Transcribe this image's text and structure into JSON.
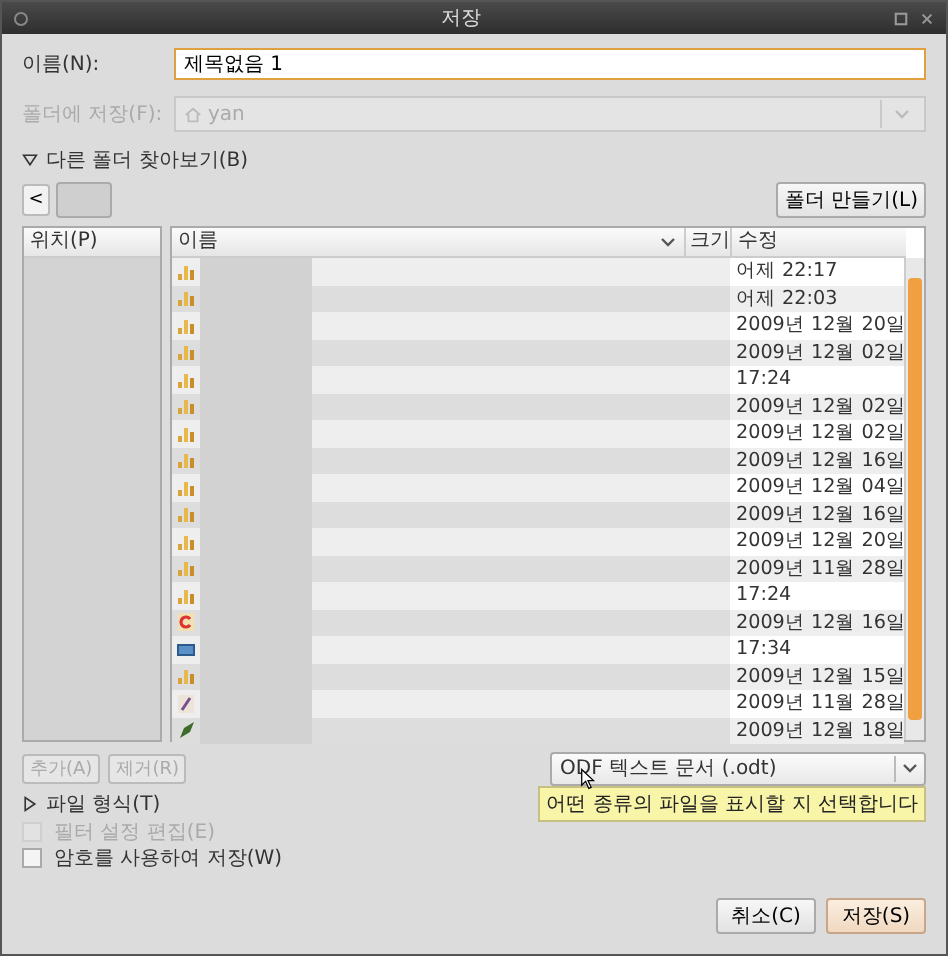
{
  "window": {
    "title": "저장"
  },
  "name_field": {
    "label": "이름(N):",
    "value": "제목없음 1"
  },
  "save_in": {
    "label": "폴더에 저장(F):",
    "value": "yan",
    "disabled": true
  },
  "browse_expander": {
    "label": "다른 폴더 찾아보기(B)",
    "expanded": true
  },
  "back_button": {
    "label": "<"
  },
  "create_folder_button": {
    "label": "폴더 만들기(L)"
  },
  "places": {
    "header": "위치(P)"
  },
  "files": {
    "columns": [
      "이름",
      "크기",
      "수정"
    ],
    "rows": [
      {
        "kind": "chart",
        "modified": "어제 22:17"
      },
      {
        "kind": "chart",
        "modified": "어제 22:03"
      },
      {
        "kind": "chart",
        "modified": "2009년 12월 20일"
      },
      {
        "kind": "chart",
        "modified": "2009년 12월 02일"
      },
      {
        "kind": "chart",
        "modified": "17:24"
      },
      {
        "kind": "chart",
        "modified": "2009년 12월 02일"
      },
      {
        "kind": "chart",
        "modified": "2009년 12월 02일"
      },
      {
        "kind": "chart",
        "modified": "2009년 12월 16일"
      },
      {
        "kind": "chart",
        "modified": "2009년 12월 04일"
      },
      {
        "kind": "chart",
        "modified": "2009년 12월 16일"
      },
      {
        "kind": "chart",
        "modified": "2009년 12월 20일"
      },
      {
        "kind": "chart",
        "modified": "2009년 11월 28일"
      },
      {
        "kind": "chart",
        "modified": "17:24"
      },
      {
        "kind": "letter",
        "modified": "2009년 12월 16일"
      },
      {
        "kind": "image",
        "modified": "17:34"
      },
      {
        "kind": "chart",
        "modified": "2009년 12월 15일"
      },
      {
        "kind": "pen",
        "modified": "2009년 11월 28일"
      },
      {
        "kind": "leaf",
        "modified": "2009년 12월 18일"
      }
    ]
  },
  "place_buttons": [
    {
      "label": "추가(A)",
      "disabled": true
    },
    {
      "label": "제거(R)",
      "disabled": true
    }
  ],
  "filter": {
    "value": "ODF 텍스트 문서 (.odt)"
  },
  "tooltip": "어떤 종류의 파일을 표시할 지 선택합니다",
  "file_type_expander": {
    "label": "파일 형식(T)",
    "expanded": false
  },
  "options": [
    {
      "label": "필터 설정 편집(E)",
      "checked": false,
      "disabled": true
    },
    {
      "label": "암호를 사용하여 저장(W)",
      "checked": false,
      "disabled": false
    }
  ],
  "buttons": [
    {
      "label": "취소(C)",
      "default": false
    },
    {
      "label": "저장(S)",
      "default": true
    }
  ]
}
